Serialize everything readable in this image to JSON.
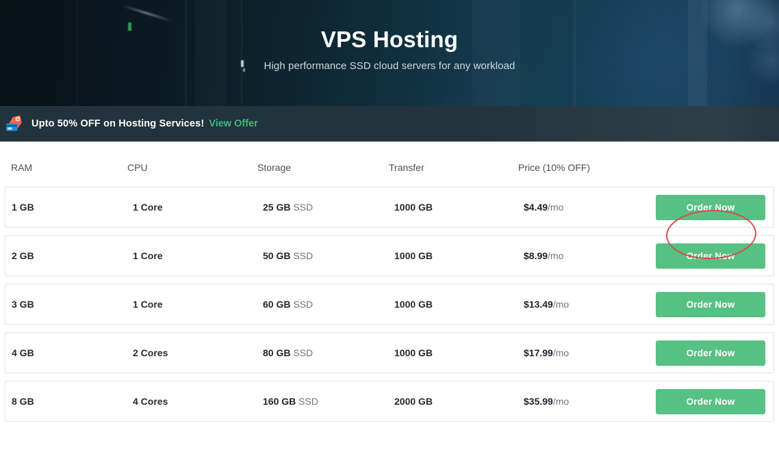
{
  "hero": {
    "title": "VPS Hosting",
    "subtitle": "High performance SSD cloud servers for any workload"
  },
  "promo": {
    "icon": "discount-tag-icon",
    "text": "Upto 50% OFF on Hosting Services!",
    "link_label": "View Offer",
    "link_color": "#3cb878",
    "bar_color": "#22333d"
  },
  "table": {
    "headers": [
      "RAM",
      "CPU",
      "Storage",
      "Transfer",
      "Price (10% OFF)",
      ""
    ],
    "action_label": "Order Now",
    "action_color": "#57c183",
    "rows": [
      {
        "ram": "1 GB",
        "cpu": "1 Core",
        "storage_size": "25 GB",
        "storage_type": "SSD",
        "transfer": "1000 GB",
        "price": "$4.49",
        "price_period": "/mo",
        "action": "Order Now"
      },
      {
        "ram": "2 GB",
        "cpu": "1 Core",
        "storage_size": "50 GB",
        "storage_type": "SSD",
        "transfer": "1000 GB",
        "price": "$8.99",
        "price_period": "/mo",
        "action": "Order Now"
      },
      {
        "ram": "3 GB",
        "cpu": "1 Core",
        "storage_size": "60 GB",
        "storage_type": "SSD",
        "transfer": "1000 GB",
        "price": "$13.49",
        "price_period": "/mo",
        "action": "Order Now"
      },
      {
        "ram": "4 GB",
        "cpu": "2 Cores",
        "storage_size": "80 GB",
        "storage_type": "SSD",
        "transfer": "1000 GB",
        "price": "$17.99",
        "price_period": "/mo",
        "action": "Order Now"
      },
      {
        "ram": "8 GB",
        "cpu": "4 Cores",
        "storage_size": "160 GB",
        "storage_type": "SSD",
        "transfer": "2000 GB",
        "price": "$35.99",
        "price_period": "/mo",
        "action": "Order Now"
      }
    ]
  },
  "annotation": {
    "shape": "ellipse",
    "color": "#d94a4a",
    "targets_row_index": 0,
    "targets": "Order Now"
  }
}
